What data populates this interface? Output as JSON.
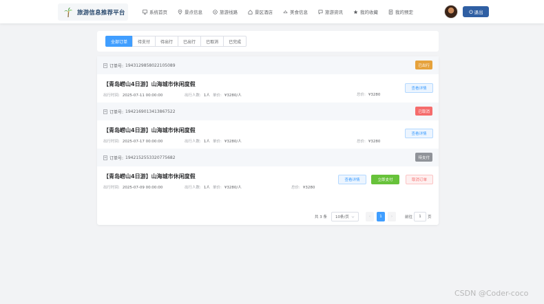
{
  "header": {
    "logo_text": "旅游信息推荐平台",
    "nav": [
      {
        "label": "系统首页",
        "icon": "monitor-icon"
      },
      {
        "label": "景点信息",
        "icon": "location-icon"
      },
      {
        "label": "旅游线路",
        "icon": "route-icon"
      },
      {
        "label": "景区酒店",
        "icon": "house-icon"
      },
      {
        "label": "美食信息",
        "icon": "food-icon"
      },
      {
        "label": "旅游资讯",
        "icon": "news-icon"
      },
      {
        "label": "我的收藏",
        "icon": "star-icon"
      },
      {
        "label": "我的预定",
        "icon": "document-icon"
      }
    ],
    "logout_label": "退出"
  },
  "tabs": [
    {
      "label": "全部订单",
      "active": true
    },
    {
      "label": "待支付"
    },
    {
      "label": "待出行"
    },
    {
      "label": "已出行"
    },
    {
      "label": "已取消"
    },
    {
      "label": "已完成"
    }
  ],
  "labels": {
    "order_no": "订单号:",
    "travel_time": "出行时间:",
    "people": "出行人数:",
    "price": "单价:",
    "total": "总价:",
    "view_detail": "查看详情",
    "pay_now": "立即支付",
    "cancel_order": "取消订单"
  },
  "orders": [
    {
      "order_no": "1943129858022105089",
      "status": "已出行",
      "status_color": "#e6a23c",
      "title": "【青岛崂山4日游】山海城市休闲度假",
      "time": "2025-07-11 00:00:00",
      "people": "1人",
      "price": "¥3280/人",
      "total": "¥3280"
    },
    {
      "order_no": "1942169013413867522",
      "status": "已取消",
      "status_color": "#f56c6c",
      "title": "【青岛崂山4日游】山海城市休闲度假",
      "time": "2025-07-17 00:00:00",
      "people": "1人",
      "price": "¥3280/人",
      "total": "¥3280"
    },
    {
      "order_no": "1942152553320775682",
      "status": "待支付",
      "status_color": "#909399",
      "title": "【青岛崂山4日游】山海城市休闲度假",
      "time": "2025-07-09 00:00:00",
      "people": "1人",
      "price": "¥3280/人",
      "total": "¥3280"
    }
  ],
  "pagination": {
    "total_text": "共 3 条",
    "page_size": "10条/页",
    "current_page": "1",
    "prev": "‹",
    "next": "›",
    "goto_label": "前往",
    "goto_value": "1",
    "page_suffix": "页"
  },
  "watermark": "CSDN @Coder-coco"
}
